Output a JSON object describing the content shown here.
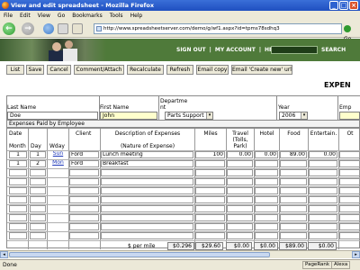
{
  "window": {
    "title": "View and edit spreadsheet - Mozilla Firefox"
  },
  "menu": [
    "File",
    "Edit",
    "View",
    "Go",
    "Bookmarks",
    "Tools",
    "Help"
  ],
  "nav": {
    "url": "http://www.spreadsheetserver.com/demo/g/wf1.aspx?id=tpms78sdhq3",
    "go_label": "Go"
  },
  "site_header": {
    "links": [
      "SIGN OUT",
      "|",
      "MY ACCOUNT",
      "|",
      "HELP"
    ],
    "search_label": "SEARCH"
  },
  "actions": [
    "List",
    "Save",
    "Cancel",
    "Comment/Attach",
    "Recalculate",
    "Refresh",
    "Email copy",
    "Email 'Create new' url"
  ],
  "page_title": "EXPEN",
  "header_fields": {
    "last_name_label": "Last Name",
    "last_name": "Doe",
    "first_name_label": "First Name",
    "first_name": "John",
    "department_label": "Departme nt",
    "department": "Parts Support",
    "year_label": "Year",
    "year": "2006",
    "emp_label": "Emp"
  },
  "expenses_caption": "Expenses Paid by Employee",
  "columns": {
    "date": "Date",
    "month": "Month",
    "day": "Day",
    "wday": "Wday",
    "client": "Client",
    "description_top": "Description of Expenses",
    "description_sub": "(Nature of Expense)",
    "miles": "Miles",
    "travel": "Travel (Tolls, Park)",
    "hotel": "Hotel",
    "food": "Food",
    "entertain": "Entertain.",
    "other": "Ot"
  },
  "rows": [
    {
      "month": "1",
      "day": "1",
      "wday": "Sun",
      "client": "Ford",
      "description": "Lunch meeting",
      "miles": "100",
      "travel": "0.00",
      "hotel": "0.00",
      "food": "89.00",
      "entertain": "0.00"
    },
    {
      "month": "1",
      "day": "2",
      "wday": "Mon",
      "client": "Ford",
      "description": "Breakfast",
      "miles": "",
      "travel": "",
      "hotel": "",
      "food": "",
      "entertain": ""
    }
  ],
  "totals": {
    "per_mile_label": "$ per mile",
    "per_mile": "$0.296",
    "miles": "$29.60",
    "travel": "$0.00",
    "hotel": "$0.00",
    "food": "$89.00",
    "entertain": "$0.00"
  },
  "status": {
    "text": "Done",
    "pagerank": "PageRank",
    "alexa": "Alexa"
  }
}
